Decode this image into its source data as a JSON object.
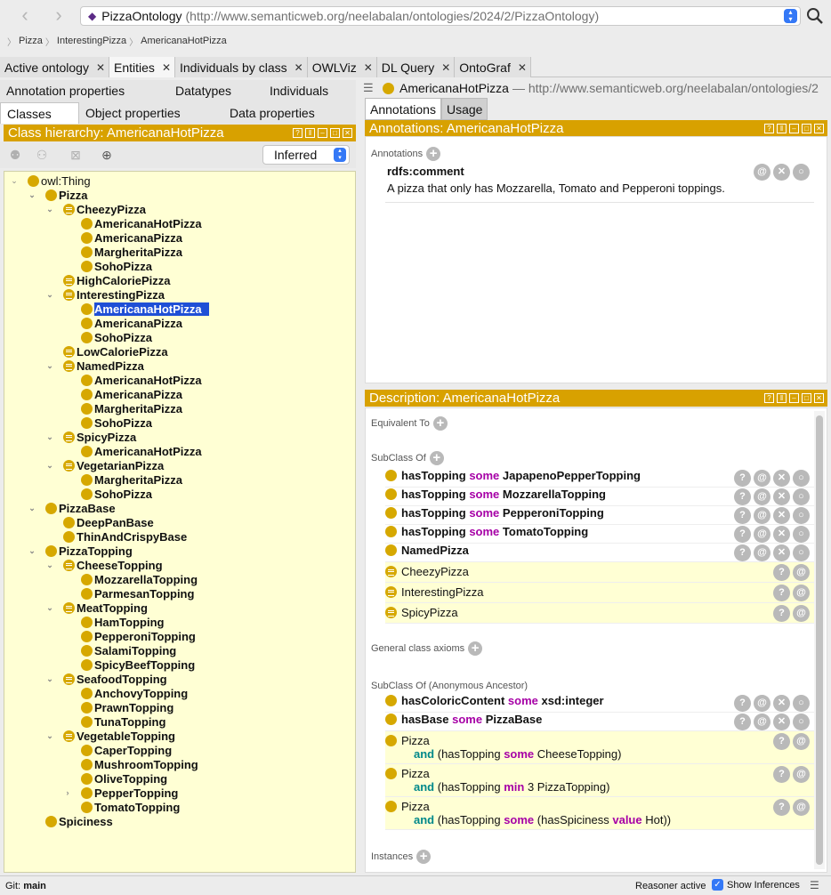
{
  "address": {
    "ontology_name": "PizzaOntology",
    "ontology_iri": "(http://www.semanticweb.org/neelabalan/ontologies/2024/2/PizzaOntology)"
  },
  "breadcrumb": [
    "Pizza",
    "InterestingPizza",
    "AmericanaHotPizza"
  ],
  "main_tabs": [
    "Active ontology",
    "Entities",
    "Individuals by class",
    "OWLViz",
    "DL Query",
    "OntoGraf"
  ],
  "left": {
    "sub_tabs_row1": [
      "Annotation properties",
      "Datatypes",
      "Individuals"
    ],
    "sub_tabs_row2": [
      "Classes",
      "Object properties",
      "Data properties"
    ],
    "header": "Class hierarchy: AmericanaHotPizza",
    "mode": "Inferred",
    "tree": [
      {
        "label": "owl:Thing",
        "plain": true
      },
      {
        "label": "Pizza"
      },
      {
        "label": "CheezyPizza"
      },
      {
        "label": "AmericanaHotPizza"
      },
      {
        "label": "AmericanaPizza"
      },
      {
        "label": "MargheritaPizza"
      },
      {
        "label": "SohoPizza"
      },
      {
        "label": "HighCaloriePizza"
      },
      {
        "label": "InterestingPizza"
      },
      {
        "label": "AmericanaHotPizza"
      },
      {
        "label": "AmericanaPizza"
      },
      {
        "label": "SohoPizza"
      },
      {
        "label": "LowCaloriePizza"
      },
      {
        "label": "NamedPizza"
      },
      {
        "label": "AmericanaHotPizza"
      },
      {
        "label": "AmericanaPizza"
      },
      {
        "label": "MargheritaPizza"
      },
      {
        "label": "SohoPizza"
      },
      {
        "label": "SpicyPizza"
      },
      {
        "label": "AmericanaHotPizza"
      },
      {
        "label": "VegetarianPizza"
      },
      {
        "label": "MargheritaPizza"
      },
      {
        "label": "SohoPizza"
      },
      {
        "label": "PizzaBase"
      },
      {
        "label": "DeepPanBase"
      },
      {
        "label": "ThinAndCrispyBase"
      },
      {
        "label": "PizzaTopping"
      },
      {
        "label": "CheeseTopping"
      },
      {
        "label": "MozzarellaTopping"
      },
      {
        "label": "ParmesanTopping"
      },
      {
        "label": "MeatTopping"
      },
      {
        "label": "HamTopping"
      },
      {
        "label": "PepperoniTopping"
      },
      {
        "label": "SalamiTopping"
      },
      {
        "label": "SpicyBeefTopping"
      },
      {
        "label": "SeafoodTopping"
      },
      {
        "label": "AnchovyTopping"
      },
      {
        "label": "PrawnTopping"
      },
      {
        "label": "TunaTopping"
      },
      {
        "label": "VegetableTopping"
      },
      {
        "label": "CaperTopping"
      },
      {
        "label": "MushroomTopping"
      },
      {
        "label": "OliveTopping"
      },
      {
        "label": "PepperTopping"
      },
      {
        "label": "TomatoTopping"
      },
      {
        "label": "Spiciness"
      }
    ]
  },
  "entity": {
    "name": "AmericanaHotPizza",
    "iri": "— http://www.semanticweb.org/neelabalan/ontologies/2"
  },
  "right_tabs": [
    "Annotations",
    "Usage"
  ],
  "annotations": {
    "header": "Annotations: AmericanaHotPizza",
    "section_label": "Annotations",
    "property": "rdfs:comment",
    "value": "A pizza that only has Mozzarella, Tomato and Pepperoni toppings."
  },
  "description": {
    "header": "Description: AmericanaHotPizza",
    "equivalent_label": "Equivalent To",
    "subclass_label": "SubClass Of",
    "gca_label": "General class axioms",
    "anon_label": "SubClass Of (Anonymous Ancestor)",
    "instances_label": "Instances",
    "subclass_rows": [
      {
        "prop": "hasTopping",
        "kw": "some",
        "filler": "JapapenoPepperTopping"
      },
      {
        "prop": "hasTopping",
        "kw": "some",
        "filler": "MozzarellaTopping"
      },
      {
        "prop": "hasTopping",
        "kw": "some",
        "filler": "PepperoniTopping"
      },
      {
        "prop": "hasTopping",
        "kw": "some",
        "filler": "TomatoTopping"
      }
    ],
    "subclass_named": "NamedPizza",
    "inferred_rows": [
      "CheezyPizza",
      "InterestingPizza",
      "SpicyPizza"
    ],
    "anon_rows": {
      "r1_prop": "hasColoricContent",
      "r1_kw": "some",
      "r1_filler": "xsd:integer",
      "r2_prop": "hasBase",
      "r2_kw": "some",
      "r2_filler": "PizzaBase",
      "r3_cls": "Pizza",
      "r3_and": "and",
      "r3_open": "(hasTopping",
      "r3_kw": "some",
      "r3_filler": "CheeseTopping)",
      "r4_cls": "Pizza",
      "r4_and": "and",
      "r4_open": "(hasTopping",
      "r4_kw": "min",
      "r4_filler": "3 PizzaTopping)",
      "r5_cls": "Pizza",
      "r5_and": "and",
      "r5_open": "(hasTopping",
      "r5_kw": "some",
      "r5_mid": "(hasSpiciness",
      "r5_kw2": "value",
      "r5_filler": "Hot))"
    }
  },
  "status": {
    "git": "Git:",
    "branch": "main",
    "reasoner": "Reasoner active",
    "show_inferences": "Show Inferences"
  },
  "colors": {
    "accent": "#d8a100",
    "tree_bg": "#ffffd4",
    "selection": "#1f4fd6",
    "keyword": "#a600a6",
    "keyword_teal": "#00888a"
  }
}
